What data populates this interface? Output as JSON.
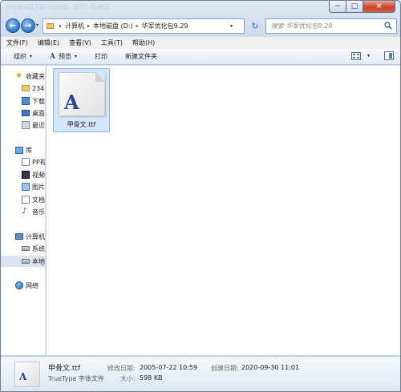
{
  "title_bar": {
    "text": "华军软件园下载的压缩包，请用7-Zip解压"
  },
  "window_controls": {
    "minimize": "−",
    "maximize": "□",
    "close": "×"
  },
  "navigation": {
    "back": "←",
    "forward": "→",
    "history_caret": "▾"
  },
  "address": {
    "crumbs": [
      "计算机",
      "本地磁盘 (D:)",
      "华军优化包9.29"
    ],
    "separator": "▸",
    "dropdown": "▾"
  },
  "refresh": {
    "glyph": "↻"
  },
  "search": {
    "placeholder": "搜索 华军优化包9.29"
  },
  "menu": [
    "文件(F)",
    "编辑(E)",
    "查看(V)",
    "工具(T)",
    "帮助(H)"
  ],
  "toolbar": {
    "organize": "组织",
    "preview": "预览",
    "print": "打印",
    "new_folder": "新建文件夹",
    "caret": "▾"
  },
  "nav_pane": {
    "favorites": "收藏夹",
    "fav_items": [
      "234",
      "下载",
      "桌面",
      "最近"
    ],
    "libraries": "库",
    "lib_items": [
      "PP视",
      "视频",
      "图片",
      "文档",
      "音乐"
    ],
    "computer": "计算机",
    "computer_items": [
      "系统",
      "本地"
    ],
    "network": "网络"
  },
  "files": [
    {
      "name": "甲骨文.ttf",
      "glyph": "A",
      "selected": true
    }
  ],
  "details": {
    "name": "甲骨文.ttf",
    "type": "TrueType 字体文件",
    "modified_label": "修改日期:",
    "modified_value": "2005-07-22 10:59",
    "created_label": "创建日期:",
    "created_value": "2020-09-30 11:01",
    "size_label": "大小:",
    "size_value": "598 KB"
  },
  "colors": {
    "accent": "#2f74c3",
    "selection": "#d4e6fa",
    "glyph": "#254a9c"
  }
}
